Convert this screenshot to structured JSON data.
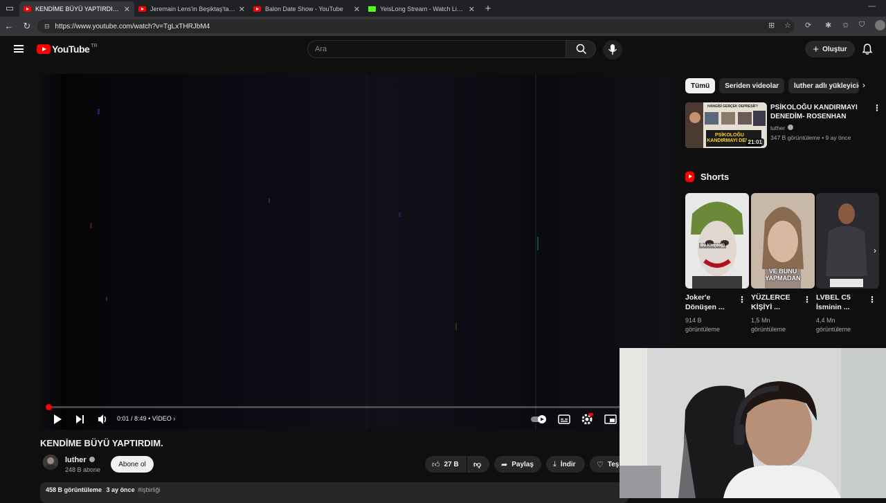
{
  "browser": {
    "tabs": [
      {
        "title": "KENDİME BÜYÜ YAPTIRDIM. - Yo",
        "active": true,
        "icon": "youtube-favicon"
      },
      {
        "title": "Jeremain Lens'in Beşiktaş'taki ma",
        "active": false,
        "icon": "youtube-favicon"
      },
      {
        "title": "Balon Date Show - YouTube",
        "active": false,
        "icon": "youtube-favicon"
      },
      {
        "title": "YeisLong Stream - Watch Live on",
        "active": false,
        "icon": "kick-favicon"
      }
    ],
    "close_glyph": "✕",
    "new_tab_glyph": "+",
    "url": "https://www.youtube.com/watch?v=TgLxTHRJbM4"
  },
  "header": {
    "logo_text": "YouTube",
    "logo_country": "TR",
    "search_placeholder": "Ara",
    "create_label": "Oluştur"
  },
  "player": {
    "time": "0:01 / 8:49",
    "chapter": "VİDEO",
    "progress_fraction": 0.002
  },
  "video": {
    "title": "KENDİME BÜYÜ YAPTIRDIM.",
    "channel_name": "luther",
    "subscribers": "248 B abone",
    "subscribe_label": "Abone ol",
    "likes": "27 B",
    "share_label": "Paylaş",
    "download_label": "İndir",
    "thanks_label": "Teş",
    "views": "458 B görüntüleme",
    "date": "3 ay önce",
    "hashtag": "#işbirliği"
  },
  "sidebar": {
    "chips": [
      "Tümü",
      "Seriden videolar",
      "luther adlı yükleyicide"
    ],
    "recommended": {
      "title": "PSİKOLOĞU KANDIRMAYI DENEDİM- ROSENHAN DENEY...",
      "channel": "luther",
      "meta": "347 B görüntüleme • 9 ay önce",
      "duration": "21:01",
      "thumb_text_top": "HANGİSİ GERÇEK DEPRESİF?",
      "thumb_text_main": "PSİKOLOĞU KANDIRMAYI DENE"
    },
    "shorts_title": "Shorts",
    "shorts": [
      {
        "title": "Joker'e Dönüşen ...",
        "views": "914 B görüntüleme",
        "overlay": "Bu kim(doğ)"
      },
      {
        "title": "YÜZLERCE KİŞİYİ ...",
        "views": "1,5 Mn görüntüleme",
        "overlay": "VE BUNU YAPMADAN"
      },
      {
        "title": "LVBEL C5 İsminin ...",
        "views": "4,4 Mn görüntüleme",
        "overlay": ""
      }
    ]
  },
  "colors": {
    "accent": "#ff0000",
    "background": "#0f0f0f",
    "chip_bg": "#272727"
  }
}
